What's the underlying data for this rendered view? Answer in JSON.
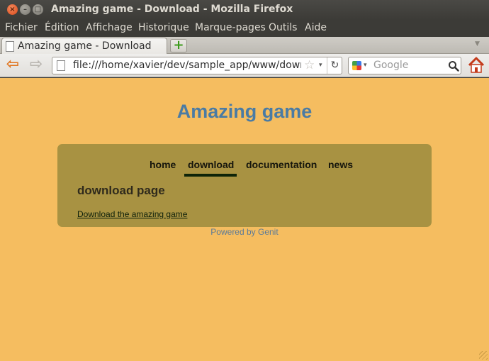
{
  "window": {
    "title": "Amazing game - Download - Mozilla Firefox",
    "close_glyph": "×",
    "min_glyph": "–",
    "max_glyph": "□"
  },
  "menubar": {
    "items": [
      "Fichier",
      "Édition",
      "Affichage",
      "Historique",
      "Marque-pages",
      "Outils",
      "Aide"
    ]
  },
  "tabs": [
    {
      "label": "Amazing game - Download",
      "active": true
    }
  ],
  "tabstrip": {
    "new_tab_glyph": "+",
    "tab_list_glyph": "▼"
  },
  "navbar": {
    "back_glyph": "⇦",
    "forward_glyph": "⇨",
    "url": "file:///home/xavier/dev/sample_app/www/download.html",
    "star_glyph": "☆",
    "dropdown_glyph": "▾",
    "reload_glyph": "↻",
    "search_placeholder": "Google"
  },
  "page": {
    "site_title": "Amazing game",
    "nav": [
      {
        "label": "home",
        "active": false
      },
      {
        "label": "download",
        "active": true
      },
      {
        "label": "documentation",
        "active": false
      },
      {
        "label": "news",
        "active": false
      }
    ],
    "heading": "download page",
    "download_link": "Download the amazing game",
    "footer": "Powered by Genit"
  },
  "colors": {
    "page_background": "#f5bd60",
    "title": "#4a7ba4",
    "panel": "#a89242",
    "active_underline": "#0e2408",
    "back_arrow": "#e07620"
  }
}
